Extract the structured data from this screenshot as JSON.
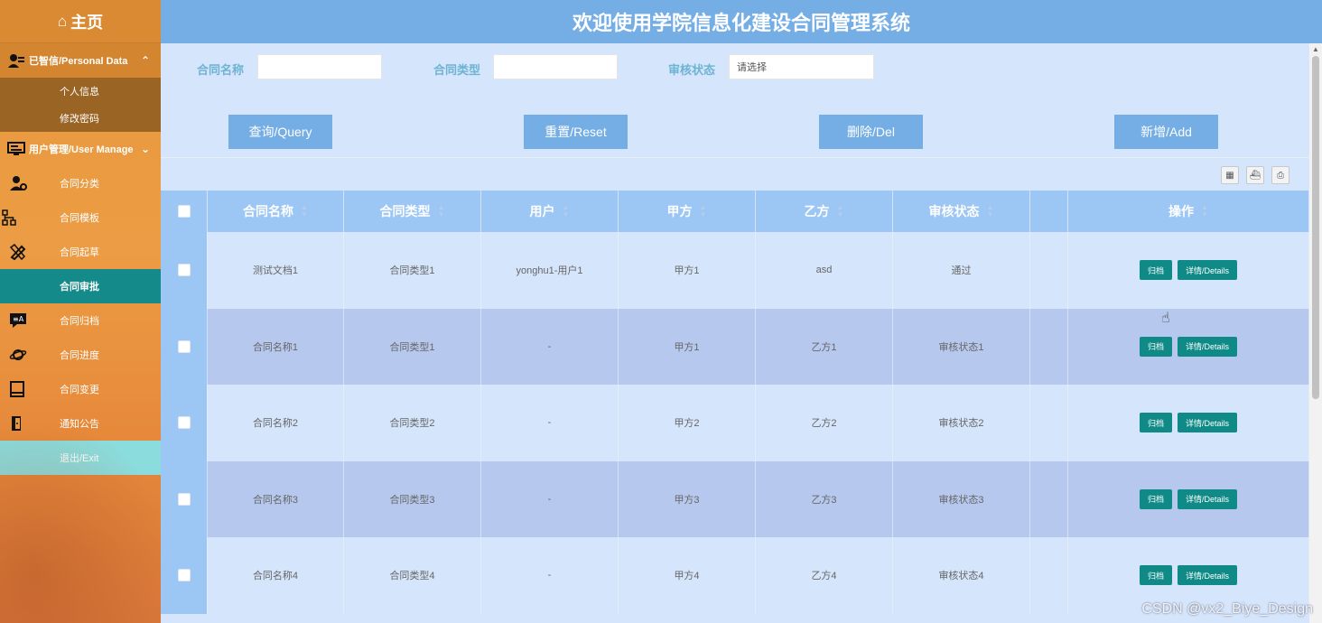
{
  "app_title": "欢迎使用学院信息化建设合同管理系统",
  "sidebar": {
    "home_label": "主页",
    "personal_group": {
      "label": "已智信/Personal Data",
      "items": [
        {
          "label": "个人信息"
        },
        {
          "label": "修改密码"
        }
      ]
    },
    "user_group": {
      "label": "用户管理/User Manage"
    },
    "menu": [
      {
        "label": "合同分类",
        "icon": "user-gear-icon"
      },
      {
        "label": "合同模板",
        "icon": "tree-icon"
      },
      {
        "label": "合同起草",
        "icon": "pencil-ruler-icon"
      },
      {
        "label": "合同审批",
        "icon": "",
        "active": true
      },
      {
        "label": "合同归档",
        "icon": "chat-icon"
      },
      {
        "label": "合同进度",
        "icon": "planet-icon"
      },
      {
        "label": "合同变更",
        "icon": "book-icon"
      },
      {
        "label": "通知公告",
        "icon": "door-icon"
      },
      {
        "label": "退出/Exit",
        "icon": ""
      }
    ]
  },
  "filters": {
    "name_label": "合同名称",
    "name_value": "",
    "type_label": "合同类型",
    "type_value": "",
    "status_label": "审核状态",
    "status_placeholder": "请选择"
  },
  "buttons": {
    "query": "查询/Query",
    "reset": "重置/Reset",
    "delete": "删除/Del",
    "add": "新增/Add"
  },
  "table": {
    "headers": [
      "合同名称",
      "合同类型",
      "用户",
      "甲方",
      "乙方",
      "审核状态",
      "",
      "操作"
    ],
    "rows": [
      [
        "测试文档1",
        "合同类型1",
        "yonghu1-用户1",
        "甲方1",
        "asd",
        "通过"
      ],
      [
        "合同名称1",
        "合同类型1",
        "-",
        "甲方1",
        "乙方1",
        "审核状态1"
      ],
      [
        "合同名称2",
        "合同类型2",
        "-",
        "甲方2",
        "乙方2",
        "审核状态2"
      ],
      [
        "合同名称3",
        "合同类型3",
        "-",
        "甲方3",
        "乙方3",
        "审核状态3"
      ],
      [
        "合同名称4",
        "合同类型4",
        "-",
        "甲方4",
        "乙方4",
        "审核状态4"
      ]
    ],
    "op_archive": "归档",
    "op_details": "详情/Details"
  },
  "watermark": "CSDN @vx2_Biye_Design",
  "colors": {
    "sidebar_orange": "#ec9c44",
    "title_blue": "#75aee5",
    "teal": "#0f8a86",
    "active_menu": "#148b8a",
    "exit_bg": "#8bdcdc"
  }
}
